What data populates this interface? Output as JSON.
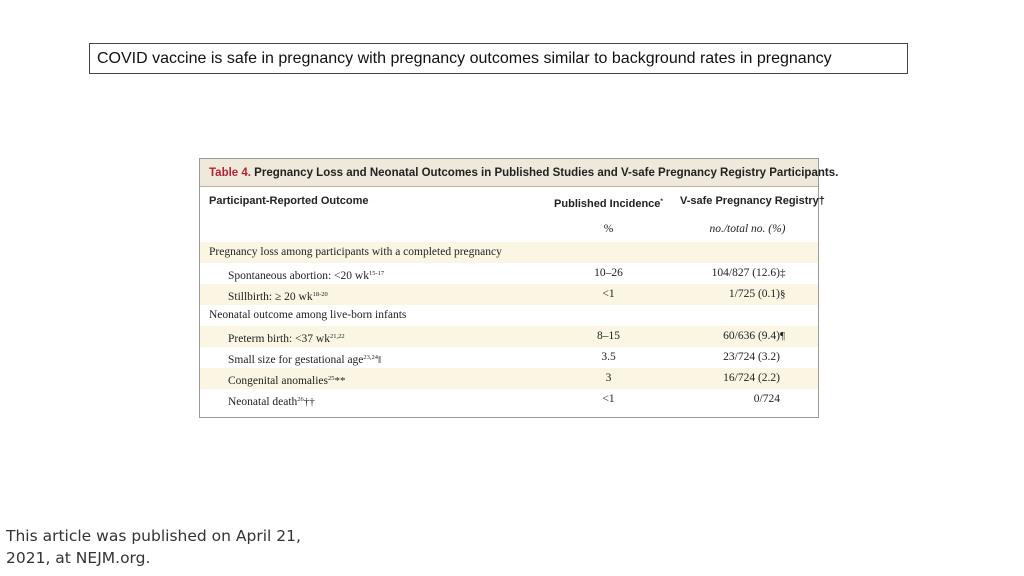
{
  "headline": "COVID vaccine is safe in pregnancy with pregnancy outcomes similar to background rates in pregnancy",
  "table": {
    "number": "Table 4.",
    "title": "Pregnancy Loss and Neonatal Outcomes in Published Studies and V-safe Pregnancy Registry Participants.",
    "headers": {
      "outcome": "Participant-Reported Outcome",
      "published": "Published Incidence",
      "published_mark": "*",
      "vsafe": "V-safe Pregnancy Registry",
      "vsafe_mark": "†"
    },
    "units": {
      "published": "%",
      "vsafe": "no./total no. (%)"
    },
    "sections": [
      {
        "label": "Pregnancy loss among participants with a completed pregnancy",
        "rows": [
          {
            "label": "Spontaneous abortion: <20 wk",
            "ref": "15-17",
            "mark": "",
            "published": "10–26",
            "vsafe": "104/827 (12.6)",
            "vsafe_mark": "‡"
          },
          {
            "label": "Stillbirth: ≥ 20 wk",
            "ref": "18-20",
            "mark": "",
            "published": "<1",
            "vsafe": "1/725 (0.1)",
            "vsafe_mark": "§"
          }
        ]
      },
      {
        "label": "Neonatal outcome among live-born infants",
        "rows": [
          {
            "label": "Preterm birth: <37 wk",
            "ref": "21,22",
            "mark": "",
            "published": "8–15",
            "vsafe": "60/636 (9.4)",
            "vsafe_mark": "¶"
          },
          {
            "label": "Small size for gestational age",
            "ref": "23,24",
            "mark": "‖",
            "published": "3.5",
            "vsafe": "23/724 (3.2)",
            "vsafe_mark": ""
          },
          {
            "label": "Congenital anomalies",
            "ref": "25",
            "mark": "**",
            "published": "3",
            "vsafe": "16/724 (2.2)",
            "vsafe_mark": ""
          },
          {
            "label": "Neonatal death",
            "ref": "26",
            "mark": "††",
            "published": "<1",
            "vsafe": "0/724",
            "vsafe_mark": ""
          }
        ]
      }
    ]
  },
  "footer": "This article was published on April 21, 2021, at NEJM.org."
}
